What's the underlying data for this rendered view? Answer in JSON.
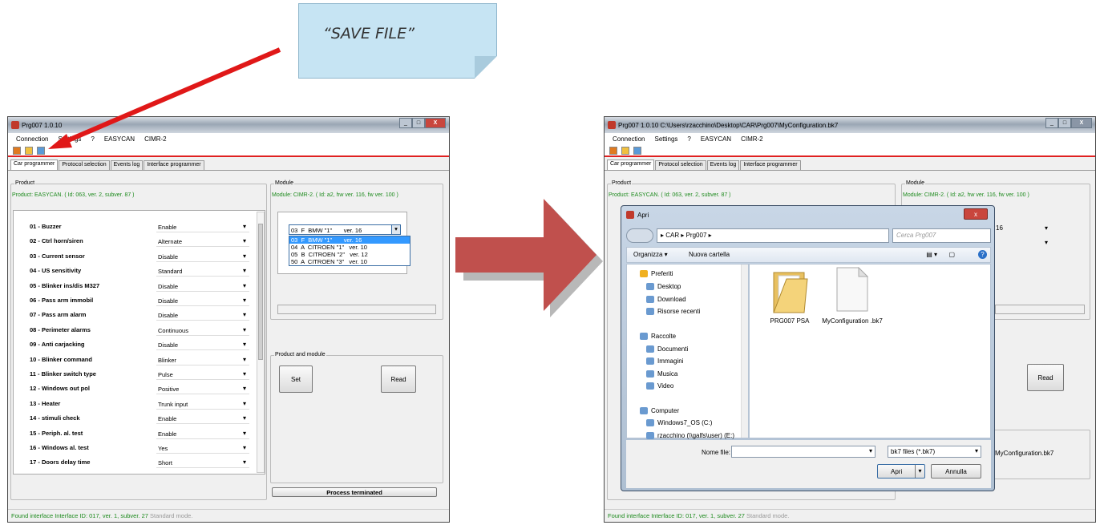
{
  "callout": {
    "text": "“SAVE FILE”"
  },
  "left": {
    "title": "Prg007  1.0.10",
    "menu": [
      "Connection",
      "Settings",
      "?",
      "EASYCAN",
      "CIMR-2"
    ],
    "tabs": [
      "Car programmer",
      "Protocol selection",
      "Events log",
      "Interface programmer"
    ],
    "product_label": "Product",
    "product_info": "Product: EASYCAN. ( Id: 063, ver. 2, subver. 87 )",
    "module_label": "Module",
    "module_info": "Module: CIMR-2. ( Id: a2, hw ver. 116, fw ver. 100 )",
    "params": [
      {
        "label": "01 - Buzzer",
        "value": "Enable"
      },
      {
        "label": "02 - Ctrl horn/siren",
        "value": "Alternate"
      },
      {
        "label": "03 - Current sensor",
        "value": "Disable"
      },
      {
        "label": "04 - US sensitivity",
        "value": "Standard"
      },
      {
        "label": "05 - Blinker ins/dis M327",
        "value": "Disable"
      },
      {
        "label": "06 - Pass arm immobil",
        "value": "Disable"
      },
      {
        "label": "07 - Pass arm alarm",
        "value": "Disable"
      },
      {
        "label": "08 - Perimeter alarms",
        "value": "Continuous"
      },
      {
        "label": "09 - Anti carjacking",
        "value": "Disable"
      },
      {
        "label": "10 - Blinker command",
        "value": "Blinker"
      },
      {
        "label": "11 - Blinker switch type",
        "value": "Pulse"
      },
      {
        "label": "12 - Windows out pol",
        "value": "Positive"
      },
      {
        "label": "13 - Heater",
        "value": "Trunk input"
      },
      {
        "label": "14 - stimuli check",
        "value": "Enable"
      },
      {
        "label": "15 - Periph. al. test",
        "value": "Enable"
      },
      {
        "label": "16 - Windows al. test",
        "value": "Yes"
      },
      {
        "label": "17 - Doors delay time",
        "value": "Short"
      }
    ],
    "vehicle_selected": "03  F  BMW \"1\"       ver. 16",
    "vehicle_options": [
      "03  F  BMW \"1\"       ver. 16",
      "04  A  CITROEN \"1\"   ver. 10",
      "05  B  CITROEN \"2\"   ver. 12",
      "50  A  CITROEN \"3\"   ver. 10"
    ],
    "product_and_module_label": "Product and module",
    "set_label": "Set",
    "read_label": "Read",
    "process_status": "Process terminated",
    "status_found": "Found interface  Interface ID: 017, ver. 1, subver. 27",
    "status_mode": "Standard mode."
  },
  "right": {
    "title": "Prg007  1.0.10  C:\\Users\\rzacchino\\Desktop\\CAR\\Prg007\\MyConfiguration.bk7",
    "menu": [
      "Connection",
      "Settings",
      "?",
      "EASYCAN",
      "CIMR-2"
    ],
    "tabs": [
      "Car programmer",
      "Protocol selection",
      "Events log",
      "Interface programmer"
    ],
    "product_label": "Product",
    "product_info": "Product: EASYCAN. ( Id: 063, ver. 2, subver. 87 )",
    "module_label": "Module",
    "module_info": "Module: CIMR-2. ( Id: a2, hw ver. 116, fw ver. 100 )",
    "vehicle_partial": "16",
    "read_label": "Read",
    "file_label": "MyConfiguration.bk7",
    "status_found": "Found interface  Interface ID: 017, ver. 1, subver. 27",
    "status_mode": "Standard mode."
  },
  "dialog": {
    "title": "Apri",
    "path": "▸  CAR  ▸  Prg007  ▸",
    "search_placeholder": "Cerca Prg007",
    "organize": "Organizza ▾",
    "new_folder": "Nuova cartella",
    "nav": [
      {
        "label": "Preferiti",
        "icon": "star-icon"
      },
      {
        "label": "Desktop",
        "icon": "desktop-icon"
      },
      {
        "label": "Download",
        "icon": "download-icon"
      },
      {
        "label": "Risorse recenti",
        "icon": "recent-icon"
      },
      {
        "label": "Raccolte",
        "icon": "library-icon"
      },
      {
        "label": "Documenti",
        "icon": "documents-icon"
      },
      {
        "label": "Immagini",
        "icon": "pictures-icon"
      },
      {
        "label": "Musica",
        "icon": "music-icon"
      },
      {
        "label": "Video",
        "icon": "video-icon"
      },
      {
        "label": "Computer",
        "icon": "computer-icon"
      },
      {
        "label": "Windows7_OS (C:)",
        "icon": "drive-icon"
      },
      {
        "label": "rzacchino (\\\\galfs\\user) (E:)",
        "icon": "network-drive-icon"
      }
    ],
    "files": [
      {
        "name": "PRG007 PSA",
        "icon": "folder-icon"
      },
      {
        "name": "MyConfiguration .bk7",
        "icon": "file-icon"
      }
    ],
    "filename_label": "Nome file:",
    "filename_value": "",
    "filetype": "bk7 files (*.bk7)",
    "open_label": "Apri",
    "cancel_label": "Annulla"
  },
  "colors": {
    "accent_red": "#e02020",
    "status_green": "#1d8a1d",
    "highlight_blue": "#3399ff"
  }
}
